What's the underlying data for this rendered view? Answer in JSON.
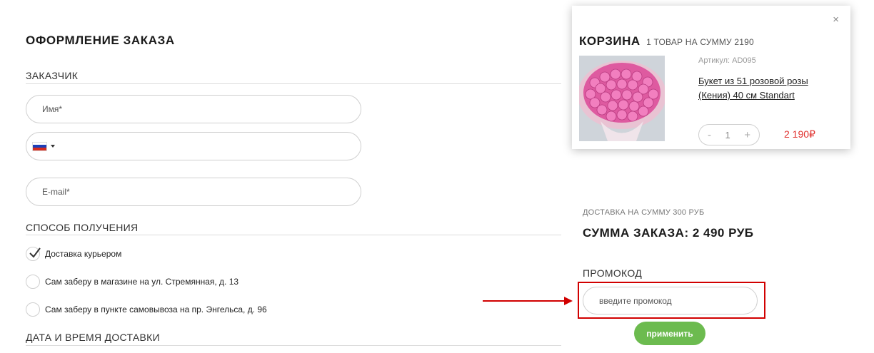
{
  "page": {
    "title": "ОФОРМЛЕНИЕ ЗАКАЗА"
  },
  "customer": {
    "section_title": "ЗАКАЗЧИК",
    "name_placeholder": "Имя*",
    "phone_country": "RU",
    "email_placeholder": "E-mail*"
  },
  "delivery_method": {
    "section_title": "СПОСОБ ПОЛУЧЕНИЯ",
    "options": [
      {
        "label": "Доставка курьером",
        "selected": true
      },
      {
        "label": "Сам заберу в магазине на ул. Стремянная, д. 13",
        "selected": false
      },
      {
        "label": "Сам заберу в пункте самовывоза на пр. Энгельса, д. 96",
        "selected": false
      }
    ]
  },
  "datetime": {
    "section_title": "ДАТА И ВРЕМЯ ДОСТАВКИ"
  },
  "cart": {
    "title": "КОРЗИНА",
    "subtitle": "1 ТОВАР НА СУММУ 2190",
    "close_icon": "×",
    "item": {
      "article": "Артикул: AD095",
      "name": "Букет из 51 розовой розы (Кения) 40 см Standart",
      "qty_minus": "-",
      "qty": "1",
      "qty_plus": "+",
      "price": "2 190₽"
    }
  },
  "summary": {
    "delivery_sum": "ДОСТАВКА НА СУММУ 300 РУБ",
    "order_sum": "СУММА ЗАКАЗА: 2 490 РУБ"
  },
  "promo": {
    "title": "ПРОМОКОД",
    "placeholder": "введите промокод",
    "apply_label": "применить"
  },
  "colors": {
    "accent_green": "#6cbb4f",
    "price_red": "#e0322f",
    "highlight_red": "#d10000"
  }
}
